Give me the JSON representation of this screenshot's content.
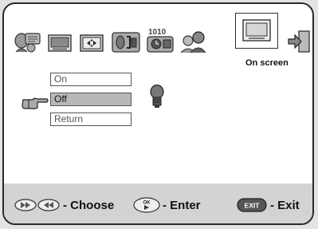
{
  "toolbar": {
    "items": [
      {
        "icon": "people-icon"
      },
      {
        "icon": "picture-icon"
      },
      {
        "icon": "screen-format-icon"
      },
      {
        "icon": "sound-icon"
      },
      {
        "icon": "teletext-clock-icon"
      },
      {
        "icon": "parental-icon"
      },
      {
        "icon": "on-screen-icon",
        "label": "On screen",
        "active": true
      },
      {
        "icon": "exit-icon"
      }
    ]
  },
  "menu": {
    "options": [
      {
        "label": "On",
        "selected": false
      },
      {
        "label": "Off",
        "selected": true
      },
      {
        "label": "Return",
        "selected": false
      }
    ],
    "pointer_icon": "hand-pointer-icon",
    "status_icon": "bulb-icon"
  },
  "footer": {
    "choose_label": "- Choose",
    "enter_label": "- Enter",
    "exit_label": "- Exit",
    "ok_text": "OK",
    "exit_text": "EXIT"
  },
  "colors": {
    "background": "#e3e3e3",
    "panel": "#ffffff",
    "footer": "#d3d3d3",
    "selected": "#b8b8b8"
  }
}
